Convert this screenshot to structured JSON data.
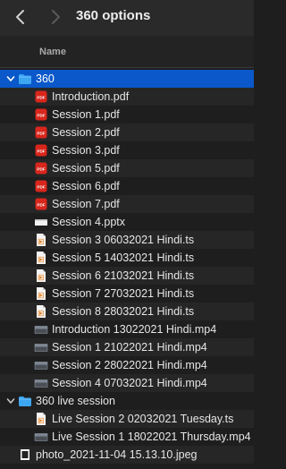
{
  "window": {
    "title": "360 options",
    "column_name": "Name"
  },
  "colors": {
    "selection": "#0a58ca",
    "folder": "#3da6f2",
    "pdf": "#d9261c",
    "ts": "#e8892f"
  },
  "rows": [
    {
      "label": "360",
      "icon": "folder-icon",
      "depth": 0,
      "expanded": true,
      "selected": true
    },
    {
      "label": "Introduction.pdf",
      "icon": "pdf-icon",
      "depth": 1
    },
    {
      "label": "Session 1.pdf",
      "icon": "pdf-icon",
      "depth": 1
    },
    {
      "label": "Session 2.pdf",
      "icon": "pdf-icon",
      "depth": 1
    },
    {
      "label": "Session 3.pdf",
      "icon": "pdf-icon",
      "depth": 1
    },
    {
      "label": "Session 5.pdf",
      "icon": "pdf-icon",
      "depth": 1
    },
    {
      "label": "Session 6.pdf",
      "icon": "pdf-icon",
      "depth": 1
    },
    {
      "label": "Session 7.pdf",
      "icon": "pdf-icon",
      "depth": 1
    },
    {
      "label": "Session 4.pptx",
      "icon": "pptx-icon",
      "depth": 1
    },
    {
      "label": "Session 3 06032021 Hindi.ts",
      "icon": "ts-file-icon",
      "depth": 1
    },
    {
      "label": "Session 5 14032021 Hindi.ts",
      "icon": "ts-file-icon",
      "depth": 1
    },
    {
      "label": "Session 6 21032021 Hindi.ts",
      "icon": "ts-file-icon",
      "depth": 1
    },
    {
      "label": "Session 7 27032021 Hindi.ts",
      "icon": "ts-file-icon",
      "depth": 1
    },
    {
      "label": "Session 8 28032021 Hindi.ts",
      "icon": "ts-file-icon",
      "depth": 1
    },
    {
      "label": "Introduction 13022021 Hindi.mp4",
      "icon": "video-thumbnail-icon",
      "depth": 1
    },
    {
      "label": "Session 1 21022021 Hindi.mp4",
      "icon": "video-thumbnail-icon",
      "depth": 1
    },
    {
      "label": "Session 2 28022021 Hindi.mp4",
      "icon": "video-thumbnail-icon",
      "depth": 1
    },
    {
      "label": "Session 4 07032021 Hindi.mp4",
      "icon": "video-thumbnail-icon",
      "depth": 1
    },
    {
      "label": "360 live session",
      "icon": "folder-icon",
      "depth": 0,
      "expanded": true
    },
    {
      "label": "Live Session 2 02032021 Tuesday.ts",
      "icon": "ts-file-icon",
      "depth": 1
    },
    {
      "label": "Live Session 1 18022021 Thursday.mp4",
      "icon": "video-thumbnail-icon",
      "depth": 1
    },
    {
      "label": "photo_2021-11-04 15.13.10.jpeg",
      "icon": "image-file-icon",
      "depth": 0
    }
  ]
}
